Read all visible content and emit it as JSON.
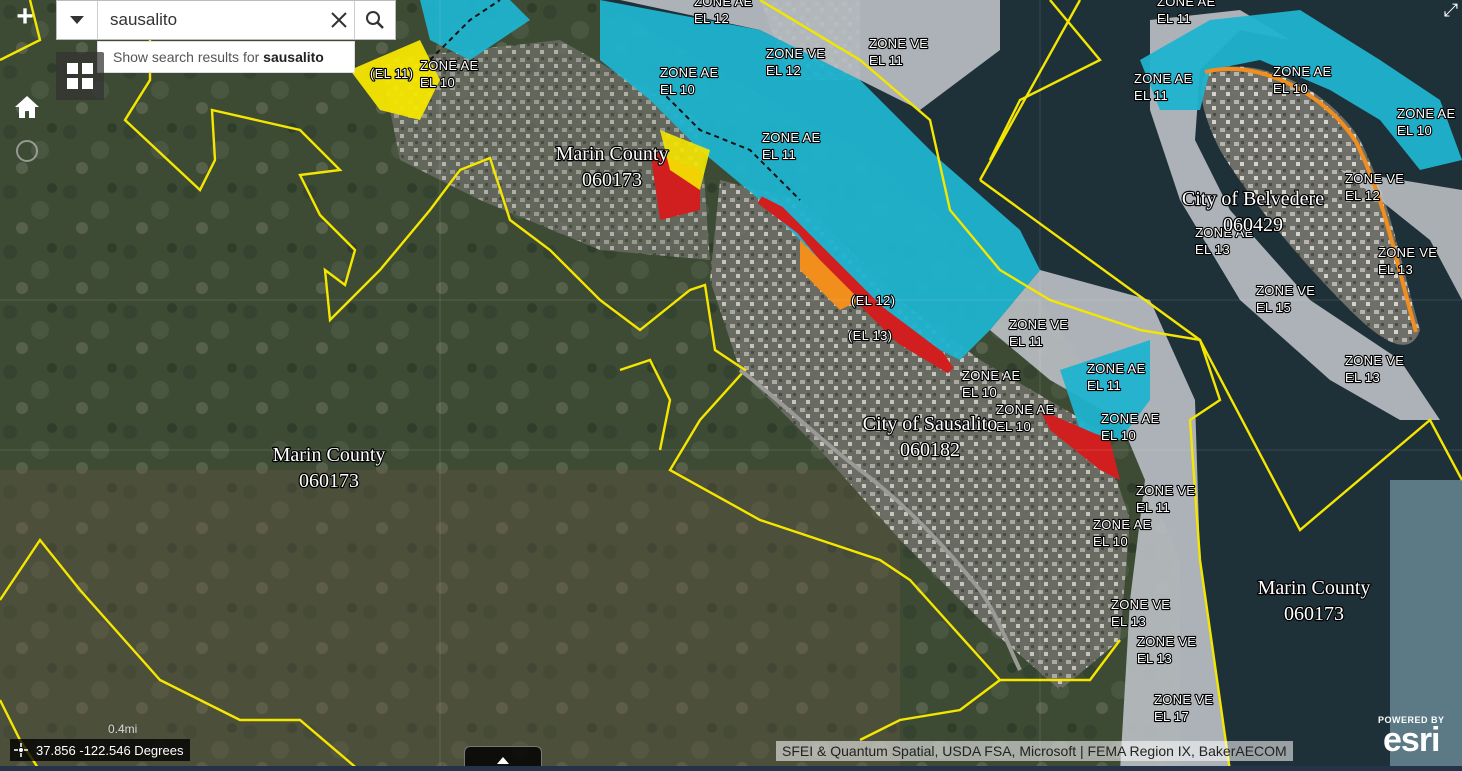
{
  "search": {
    "value": "sausalito",
    "suggestion_prefix": "Show search results for ",
    "suggestion_term": "sausalito"
  },
  "controls": {
    "zoom_in_label": "+",
    "basemap_icon": "grid-icon",
    "home_icon": "home-icon",
    "locate_icon": "locate-icon",
    "fullscreen_label": "⤢"
  },
  "coordinates": "37.856 -122.546 Degrees",
  "scale_label": "0.4mi",
  "attribution": "SFEI & Quantum Spatial, USDA FSA, Microsoft | FEMA Region IX, BakerAECOM",
  "esri": {
    "powered_by": "POWERED BY",
    "word": "esri"
  },
  "colors": {
    "zone_ae": "#1fb3cf",
    "zone_ve": "#b9bec2",
    "boundary": "#f5e600",
    "high_risk_red": "#d11f1f",
    "moderate_orange": "#f28e1c",
    "water": "#1e3038"
  },
  "communities": [
    {
      "name": "Marin County",
      "code": "060173"
    },
    {
      "name": "Marin County",
      "code": "060173"
    },
    {
      "name": "City of Sausalito",
      "code": "060182"
    },
    {
      "name": "City of Belvedere",
      "code": "060429"
    },
    {
      "name": "Marin County",
      "code": "060173"
    }
  ],
  "zones": [
    {
      "zone": "ZONE AE",
      "el": "EL 12"
    },
    {
      "zone": "ZONE AE",
      "el": "EL 11"
    },
    {
      "zone": "ZONE VE",
      "el": "EL 12"
    },
    {
      "zone": "ZONE VE",
      "el": "EL 11"
    },
    {
      "zone": "ZONE AE",
      "el": "EL 10"
    },
    {
      "zone": "ZONE AE",
      "el": "EL 10"
    },
    {
      "zone": "ZONE AE",
      "el": "EL 11"
    },
    {
      "zone": "ZONE AE",
      "el": "EL 11"
    },
    {
      "zone": "ZONE AE",
      "el": "EL 10"
    },
    {
      "zone": "ZONE AE",
      "el": "EL 10"
    },
    {
      "zone": "ZONE VE",
      "el": "EL 12"
    },
    {
      "zone": "ZONE AE",
      "el": "EL 13"
    },
    {
      "zone": "ZONE VE",
      "el": "EL 13"
    },
    {
      "zone": "ZONE VE",
      "el": "EL 15"
    },
    {
      "zone": "ZONE VE",
      "el": "EL 13"
    },
    {
      "zone": "ZONE VE",
      "el": "EL 11"
    },
    {
      "zone": "ZONE AE",
      "el": "EL 11"
    },
    {
      "zone": "ZONE AE",
      "el": "EL 10"
    },
    {
      "zone": "ZONE AE",
      "el": "EL 10"
    },
    {
      "zone": "ZONE AE",
      "el": "EL 10"
    },
    {
      "zone": "ZONE VE",
      "el": "EL 11"
    },
    {
      "zone": "ZONE AE",
      "el": "EL 10"
    },
    {
      "zone": "ZONE VE",
      "el": "EL 13"
    },
    {
      "zone": "ZONE VE",
      "el": "EL 13"
    },
    {
      "zone": "ZONE VE",
      "el": "EL 17"
    }
  ],
  "el_only": [
    "(EL 11)",
    "(EL 12)",
    "(EL 13)"
  ]
}
